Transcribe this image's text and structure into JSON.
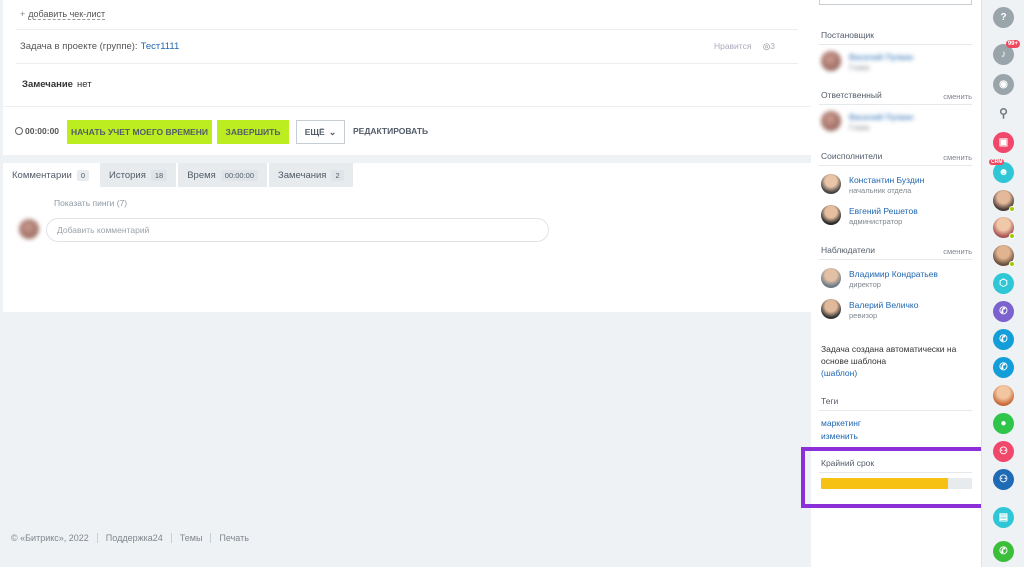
{
  "task": {
    "checklist_add": "добавить чек-лист",
    "project_label": "Задача в проекте (группе):",
    "project_name": "Тест1111",
    "likes_label": "Нравится",
    "views_count": "3",
    "remark_label": "Замечание",
    "remark_value": "нет"
  },
  "controls": {
    "timer": "00:00:00",
    "start_time_button": "НАЧАТЬ УЧЕТ МОЕГО ВРЕМЕНИ",
    "finish_button": "ЗАВЕРШИТЬ",
    "more_button": "ЕЩЁ",
    "edit_button": "РЕДАКТИРОВАТЬ"
  },
  "tabs": [
    {
      "label": "Комментарии",
      "count": "0"
    },
    {
      "label": "История",
      "count": "18"
    },
    {
      "label": "Время",
      "count": "00:00:00"
    },
    {
      "label": "Замечания",
      "count": "2"
    }
  ],
  "comments": {
    "pings_link": "Показать пинги (7)",
    "input_placeholder": "Добавить комментарий"
  },
  "footer": {
    "copyright": "© «Битрикс», 2022",
    "support": "Поддержка24",
    "themes": "Темы",
    "print": "Печать"
  },
  "sidebar": {
    "creator_heading": "Постановщик",
    "creator_name": "Василий Пупкин",
    "creator_role": "Глава",
    "responsible_heading": "Ответственный",
    "responsible_change": "сменить",
    "responsible_name": "Василий Пупкин",
    "responsible_role": "Глава",
    "accomplices_heading": "Соисполнители",
    "accomplices_change": "сменить",
    "accomplices": [
      {
        "name": "Константин Буздин",
        "role": "начальник отдела"
      },
      {
        "name": "Евгений Решетов",
        "role": "администратор"
      }
    ],
    "observers_heading": "Наблюдатели",
    "observers_change": "сменить",
    "observers": [
      {
        "name": "Владимир Кондратьев",
        "role": "директор"
      },
      {
        "name": "Валерий Величко",
        "role": "ревизор"
      }
    ],
    "auto_created_text": "Задача создана автоматически на основе шаблона",
    "template_link": "(шаблон)",
    "tags_heading": "Теги",
    "tag": "маркетинг",
    "tag_edit": "изменить",
    "deadline_label": "Крайний срок",
    "deadline_progress": 0.84,
    "highlight_color": "#8b2fd8",
    "progress_color": "#f7c114"
  },
  "rail": {
    "notifications_badge": "99+",
    "crm_badge": "CRM",
    "icons": [
      "help-icon",
      "bell-icon",
      "chat-icon",
      "search-icon",
      "calendar-icon",
      "crm-contact-icon",
      "user-avatar-icon",
      "user-avatar-icon",
      "user-avatar-icon",
      "android-icon",
      "viber-icon",
      "phone-icon",
      "phone-icon",
      "user-avatar-icon",
      "user-icon",
      "group-icon",
      "meeting-icon",
      "document-icon",
      "call-icon"
    ]
  },
  "colors": {
    "accent_green": "#bbed21",
    "link_blue": "#2067b0"
  }
}
